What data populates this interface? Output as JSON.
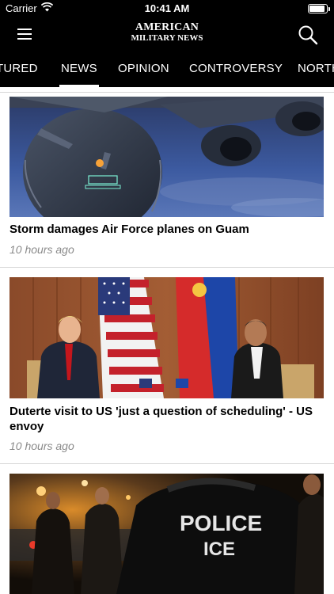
{
  "status_bar": {
    "carrier": "Carrier",
    "time": "10:41 AM",
    "battery_level": 0.92
  },
  "nav": {
    "logo_line1": "AMERICAN",
    "logo_line2": "MILITARY NEWS",
    "menu_icon": "hamburger-menu-icon",
    "search_icon": "search-icon"
  },
  "tabs": [
    {
      "label": "TURED",
      "active": false
    },
    {
      "label": "NEWS",
      "active": true
    },
    {
      "label": "OPINION",
      "active": false
    },
    {
      "label": "CONTROVERSY",
      "active": false
    },
    {
      "label": "NORTH",
      "active": false
    }
  ],
  "articles": [
    {
      "headline": "Storm damages Air Force planes on Guam",
      "time": "10 hours ago"
    },
    {
      "headline": "Duterte visit to US 'just a question of scheduling' - US envoy",
      "time": "10 hours ago"
    },
    {
      "headline": "",
      "time": ""
    }
  ],
  "colors": {
    "bar_background": "#000000",
    "feed_background": "#ffffff",
    "timestamp": "#8a8a8a",
    "divider": "#d6d6d6"
  }
}
